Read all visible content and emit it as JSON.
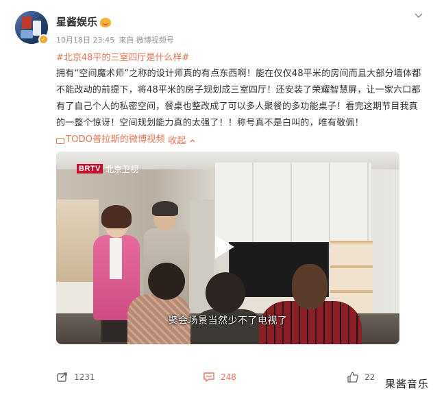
{
  "post": {
    "author": "星酱娱乐",
    "date": "10月18日 23:45",
    "source": "来自 微博视频号",
    "topic": "#北京48平的三室四厅是什么样#",
    "text_main": "拥有“空间魔术师”之称的设计师真的有点东西啊！能在仅仅48平米的房间而且大部分墙体都不能改动的前提下，将48平米的房子规划成三室四厅！还安装了荣耀智慧屏，让一家六口都有了自己个人的私密空间，餐桌也整改成了可以多人聚餐的多功能桌子！看完这期节目我真的一整个惊讶！空间规划能力真的太强了！！称号真不是白叫的，唯有敬佩！",
    "video_link": "TODO普拉斯的微博视频",
    "collapse": "收起",
    "collapse_icon": "chevron-up-icon"
  },
  "video": {
    "channel_logo": "BRTV",
    "channel_name": "北京卫视",
    "subtitle": "聚会场景当然少不了电视了"
  },
  "actions": {
    "share_count": "1231",
    "comment_count": "248",
    "like_count": "22"
  },
  "watermark": "果酱音乐",
  "colors": {
    "accent": "#eb7350",
    "verified": "#f5a623",
    "text": "#333333",
    "meta": "#939393"
  }
}
